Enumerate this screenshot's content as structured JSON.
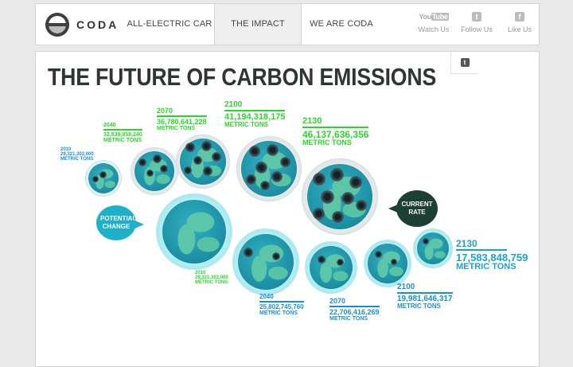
{
  "nav": {
    "brand": "CODA",
    "items": [
      {
        "label": "ALL-ELECTRIC CAR"
      },
      {
        "label": "THE IMPACT",
        "active": true
      },
      {
        "label": "WE ARE CODA"
      }
    ],
    "social": [
      {
        "label": "Watch Us",
        "icon": "youtube-icon"
      },
      {
        "label": "Follow Us",
        "icon": "twitter-icon"
      },
      {
        "label": "Like Us",
        "icon": "facebook-icon"
      }
    ]
  },
  "page": {
    "title": "THE FUTURE OF CARBON EMISSIONS",
    "share_icon": "twitter-icon"
  },
  "current_rate": {
    "label": "CURRENT RATE",
    "color": "#2bd62b",
    "points": [
      {
        "year": "2010",
        "value": "29,321,302,000",
        "unit": "METRIC TONS"
      },
      {
        "year": "2040",
        "value": "32,839,858,240",
        "unit": "METRIC TONS"
      },
      {
        "year": "2070",
        "value": "36,780,641,228",
        "unit": "METRIC TONS"
      },
      {
        "year": "2100",
        "value": "41,194,318,175",
        "unit": "METRIC TONS"
      },
      {
        "year": "2130",
        "value": "46,137,636,356",
        "unit": "METRIC TONS"
      }
    ]
  },
  "potential_change": {
    "label": "POTENTIAL CHANGE",
    "color": "#1a8fcf",
    "points": [
      {
        "year": "2010",
        "value": "29,321,302,000",
        "unit": "METRIC TONS"
      },
      {
        "year": "2040",
        "value": "25,802,745,760",
        "unit": "METRIC TONS"
      },
      {
        "year": "2070",
        "value": "22,706,416,269",
        "unit": "METRIC TONS"
      },
      {
        "year": "2100",
        "value": "19,981,646,317",
        "unit": "METRIC TONS"
      },
      {
        "year": "2130",
        "value": "17,583,848,759",
        "unit": "METRIC TONS"
      }
    ]
  }
}
